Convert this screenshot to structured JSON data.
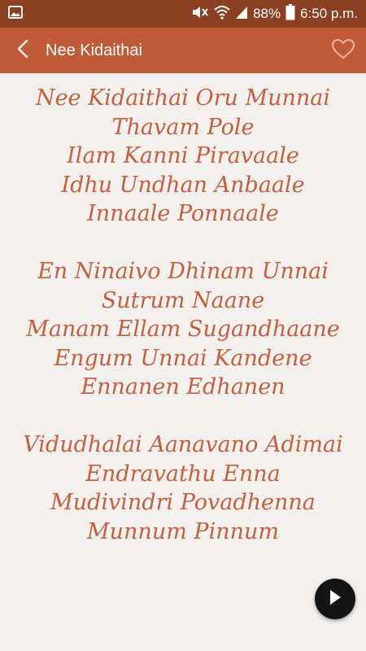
{
  "status_bar": {
    "battery_percent": "88%",
    "time": "6:50 p.m.",
    "icons": [
      "image-notification-icon",
      "mute-icon",
      "wifi-icon",
      "signal-icon",
      "battery-icon"
    ]
  },
  "app_bar": {
    "title": "Nee Kidaithai",
    "back_icon": "chevron-left-icon",
    "favorite_icon": "heart-outline-icon"
  },
  "lyrics": {
    "stanzas": [
      [
        "Nee Kidaithai Oru Munnai",
        "Thavam Pole",
        "Ilam Kanni Piravaale",
        "Idhu Undhan Anbaale",
        "Innaale Ponnaale"
      ],
      [
        "En Ninaivo Dhinam Unnai",
        "Sutrum Naane",
        "Manam Ellam Sugandhaane",
        "Engum Unnai Kandene",
        "Ennanen Edhanen"
      ],
      [
        "Vidudhalai Aanavano Adimai",
        "Endravathu Enna",
        "Mudivindri Povadhenna",
        "Munnum Pinnum"
      ]
    ]
  },
  "fab": {
    "icon": "play-icon"
  },
  "colors": {
    "status_bar": "#8c3f22",
    "app_bar": "#c05a37",
    "background": "#f3f0ee",
    "lyrics_text": "#c4603f",
    "fab": "#151515"
  }
}
